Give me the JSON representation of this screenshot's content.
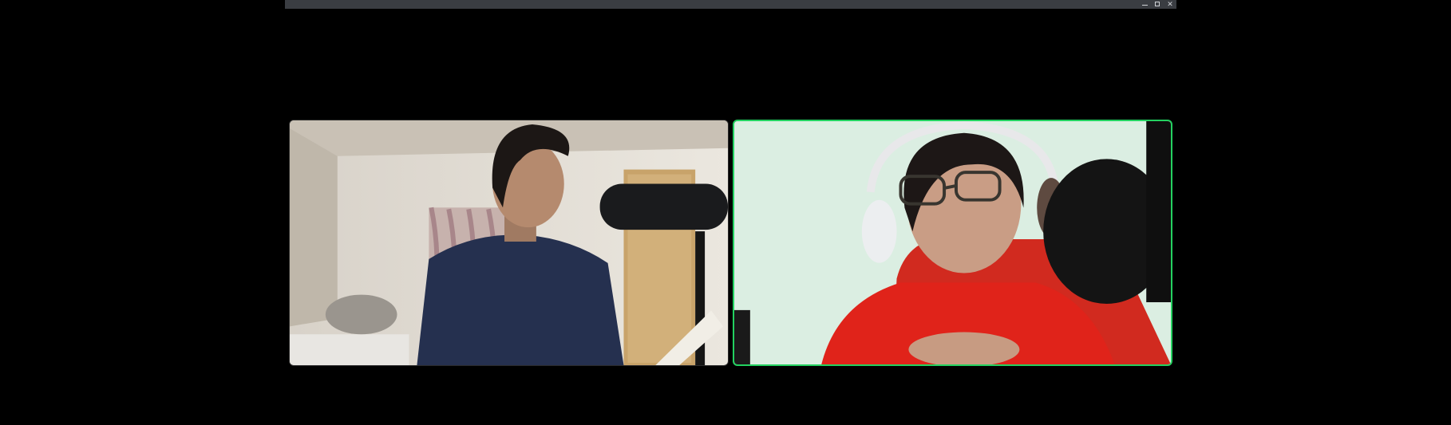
{
  "window": {
    "title_bar_color": "#3a3d42",
    "controls": [
      "minimize-icon",
      "maximize-icon",
      "close-icon"
    ]
  },
  "meeting": {
    "participants": [
      {
        "active_speaker": false
      },
      {
        "active_speaker": true,
        "highlight_color": "#23d160"
      }
    ]
  }
}
